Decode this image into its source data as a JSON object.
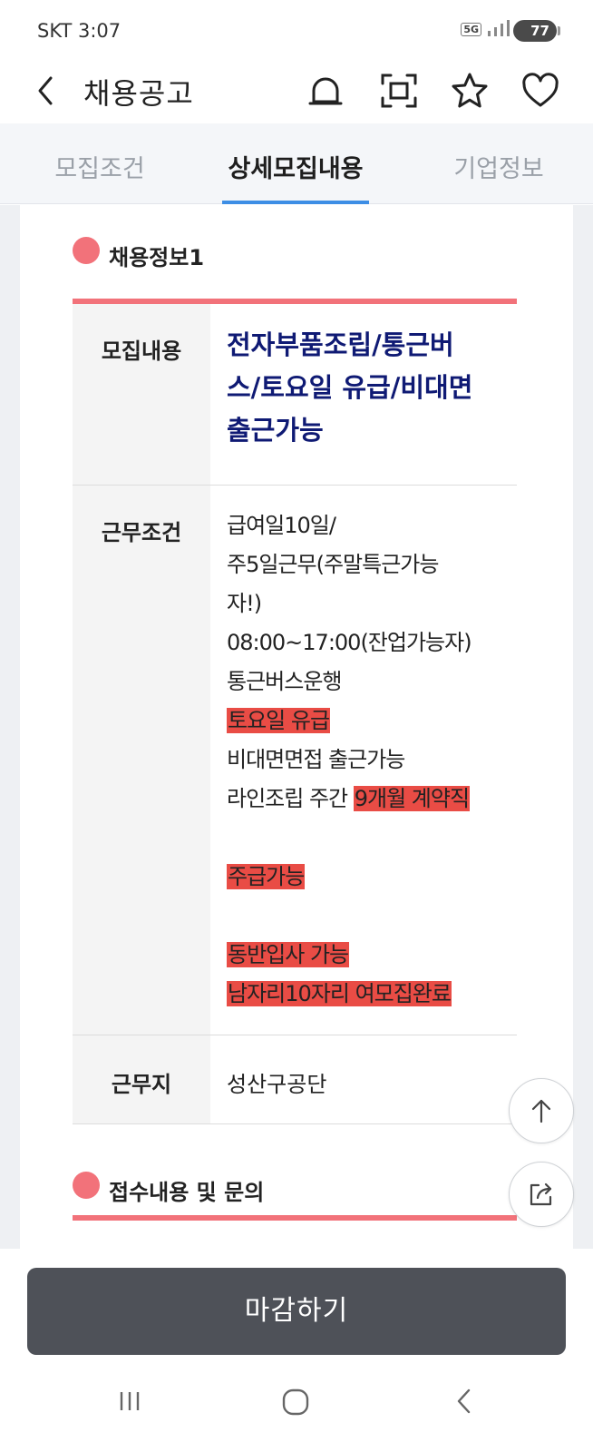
{
  "status_bar": {
    "carrier_time": "SKT 3:07",
    "network": "5G",
    "battery": "77"
  },
  "app_bar": {
    "title": "채용공고",
    "icons": [
      "back-arrow-icon",
      "bell-icon",
      "scan-icon",
      "star-icon",
      "heart-icon"
    ]
  },
  "tabs": [
    {
      "label": "모집조건",
      "active": false
    },
    {
      "label": "상세모집내용",
      "active": true
    },
    {
      "label": "기업정보",
      "active": false
    }
  ],
  "section1": {
    "heading": "채용정보1",
    "rows": {
      "recruit": {
        "header": "모집내용",
        "lines": [
          "전자부품조립/통근버",
          "스/토요일 유급/비대면",
          "출근가능"
        ]
      },
      "conditions": {
        "header": "근무조건",
        "lines": [
          {
            "text": "급여일10일/",
            "highlight": ""
          },
          {
            "text": "주5일근무(주말특근가능",
            "highlight": ""
          },
          {
            "text": "자!)",
            "highlight": ""
          },
          {
            "text": "08:00~17:00(잔업가능자)",
            "highlight": ""
          },
          {
            "text": "통근버스운행",
            "highlight": ""
          },
          {
            "text": "",
            "highlight": "토요일 유급"
          },
          {
            "text": "비대면면접 출근가능",
            "highlight": ""
          },
          {
            "text": "라인조립 주간 ",
            "highlight": "9개월 계약직"
          },
          {
            "text": "",
            "highlight": ""
          },
          {
            "text": "",
            "highlight": "주급가능"
          },
          {
            "text": "",
            "highlight": ""
          },
          {
            "text": "",
            "highlight": "동반입사 가능"
          },
          {
            "text": "",
            "highlight": "남자리10자리 여모집완료"
          }
        ]
      },
      "location": {
        "header": "근무지",
        "value": "성산구공단"
      }
    }
  },
  "section2": {
    "heading": "접수내용 및 문의"
  },
  "buttons": {
    "close_label": "마감하기"
  },
  "colors": {
    "accent_tab": "#3d8ee5",
    "section_pink": "#f2727a",
    "highlight_red": "#e94c45",
    "title_navy": "#0f1a74",
    "close_button": "#4e5158"
  }
}
